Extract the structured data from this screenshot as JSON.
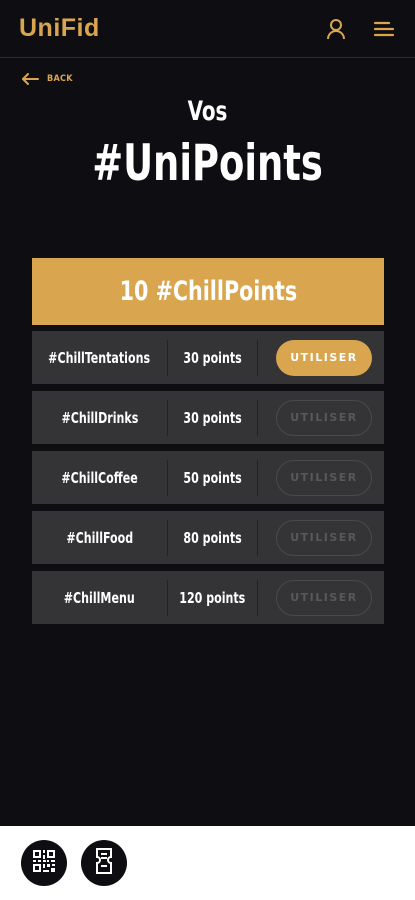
{
  "header": {
    "logo": "UniFid",
    "icons": [
      "user-icon",
      "menu-icon"
    ]
  },
  "nav": {
    "back_label": "BACK"
  },
  "title": {
    "line1": "Vos",
    "line2": "#UniPoints"
  },
  "balance": {
    "text": "10 #ChillPoints"
  },
  "rewards": [
    {
      "name": "#ChillTentations",
      "points": "30 points",
      "button": "UTILISER",
      "enabled": true
    },
    {
      "name": "#ChillDrinks",
      "points": "30 points",
      "button": "UTILISER",
      "enabled": false
    },
    {
      "name": "#ChillCoffee",
      "points": "50 points",
      "button": "UTILISER",
      "enabled": false
    },
    {
      "name": "#ChillFood",
      "points": "80 points",
      "button": "UTILISER",
      "enabled": false
    },
    {
      "name": "#ChillMenu",
      "points": "120 points",
      "button": "UTILISER",
      "enabled": false
    }
  ],
  "bottom_bar": {
    "icons": [
      "qr-code-icon",
      "ticket-icon"
    ]
  },
  "colors": {
    "accent": "#d9a54e",
    "background": "#0e0e12",
    "row": "#343436"
  }
}
